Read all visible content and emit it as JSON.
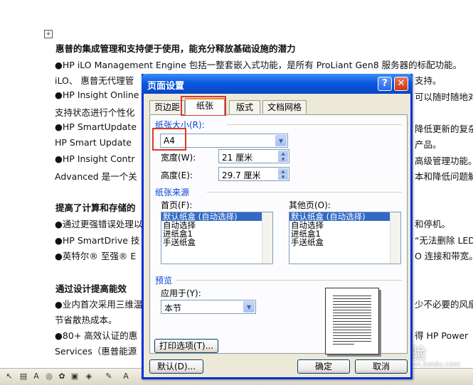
{
  "document": {
    "anchor": "+",
    "lines": [
      {
        "text": "惠普的集成管理和支持便于使用，能充分释放基础设施的潜力",
        "bold": true
      },
      {
        "text": "●HP iLO Management Engine 包括一整套嵌入式功能，是所有 ProLiant Gen8 服务器的标配功能。"
      },
      {
        "text": "  iLO、 惠普无代理管",
        "tail": "支持。"
      },
      {
        "text": "●HP Insight Online",
        "tail": "可以随时随地对"
      },
      {
        "text": "  支持状态进行个性化",
        "tail": ""
      },
      {
        "text": "●HP SmartUpdate",
        "tail": "降低更新的复杂"
      },
      {
        "text": "  HP Smart Update",
        "tail": "产品。"
      },
      {
        "text": "●HP Insight Contr",
        "tail": "高级管理功能。"
      },
      {
        "text": "  Advanced 是一个关",
        "tail": "本和降低问题解"
      },
      {
        "text": ""
      },
      {
        "text": "提高了计算和存储的",
        "bold": true
      },
      {
        "text": "●通过更强错误处理以",
        "tail": "和停机。"
      },
      {
        "text": "●HP SmartDrive 技",
        "tail": "“无法删除 LED"
      },
      {
        "text": "●英特尔® 至强® E",
        "tail": "O 连接和带宽。"
      },
      {
        "text": ""
      },
      {
        "text": "通过设计提高能效",
        "bold": true
      },
      {
        "text": "●业内首次采用三维温",
        "tail": "少不必要的风扇"
      },
      {
        "text": "  节省散热成本。"
      },
      {
        "text": "●80+ 高效认证的惠",
        "tail": "得 HP Power"
      },
      {
        "text": "  Services（惠普能源",
        "tail": ""
      }
    ]
  },
  "watermark": {
    "text": "Bai 经验",
    "sub": "jingyan.baidu.com"
  },
  "dialog": {
    "title": "页面设置",
    "help_glyph": "?",
    "close_glyph": "✕",
    "tabs": [
      {
        "label": "页边距",
        "active": false
      },
      {
        "label": "纸张",
        "active": true
      },
      {
        "label": "版式",
        "active": false
      },
      {
        "label": "文档网格",
        "active": false
      }
    ],
    "paper_size": {
      "group_label": "纸张大小(R):",
      "value": "A4",
      "width_label": "宽度(W):",
      "width_value": "21 厘米",
      "height_label": "高度(E):",
      "height_value": "29.7 厘米"
    },
    "paper_source": {
      "group_label": "纸张来源",
      "first_page_label": "首页(F):",
      "other_pages_label": "其他页(O):",
      "options": [
        "默认纸盒 (自动选择)",
        "自动选择",
        "进纸盒1",
        "手送纸盒"
      ],
      "selected_index": 0
    },
    "preview": {
      "group_label": "预览",
      "apply_label": "应用于(Y):",
      "apply_value": "本节"
    },
    "buttons": {
      "print_options": "打印选项(T)...",
      "default": "默认(D)...",
      "ok": "确定",
      "cancel": "取消"
    }
  },
  "colors": {
    "highlight": "#e0332d",
    "title_bar": "#0a58e0",
    "selection": "#316ac5"
  }
}
